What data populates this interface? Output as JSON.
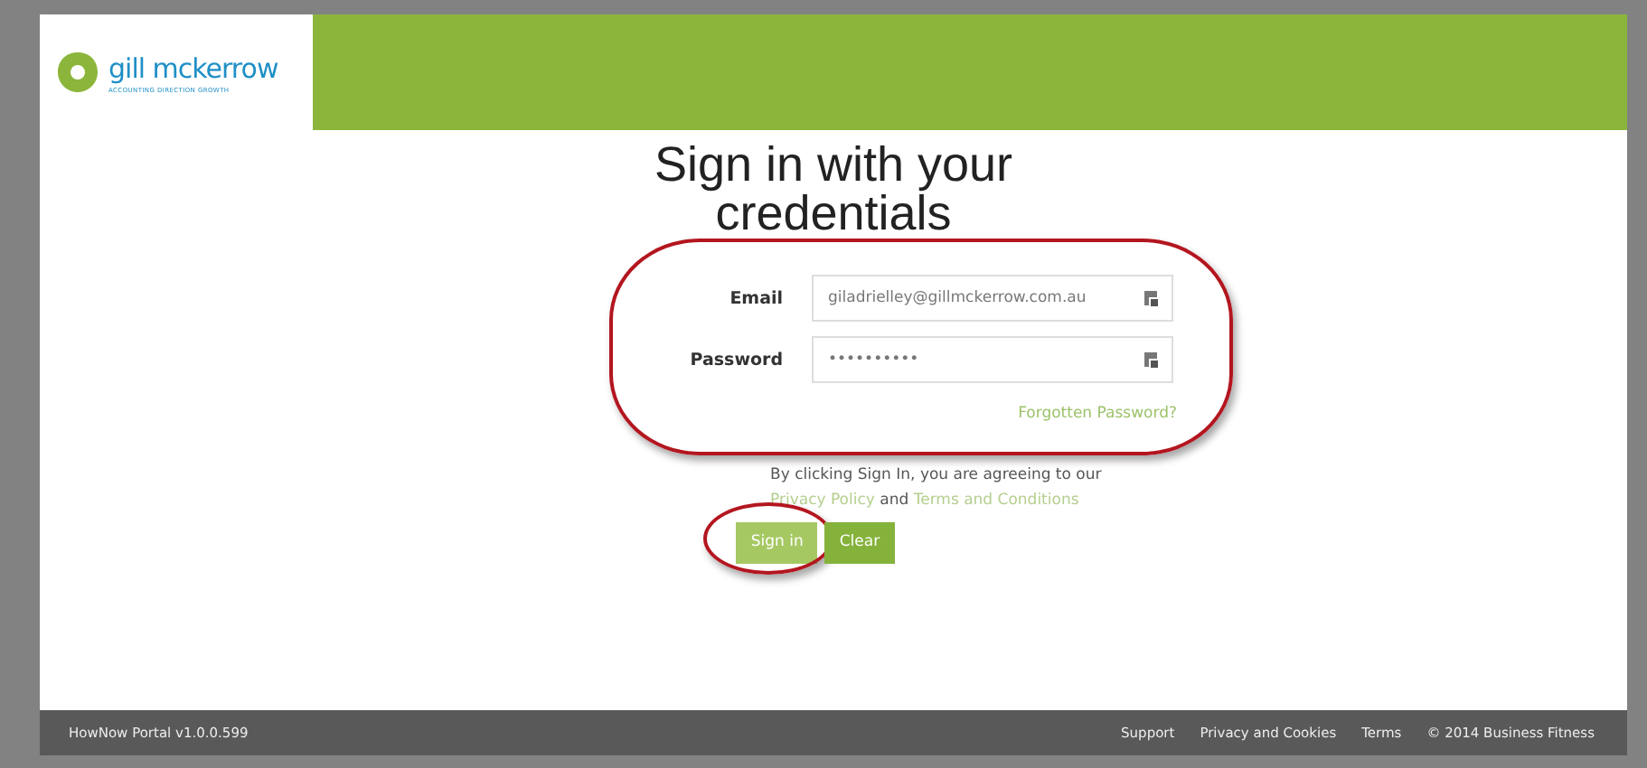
{
  "header": {
    "logo": {
      "name": "gill mckerrow",
      "tagline": "ACCOUNTING DIRECTION GROWTH"
    }
  },
  "title": "Sign in with your credentials",
  "form": {
    "highlighted": true,
    "fields": [
      {
        "label": "Email",
        "value": "giladrielley@gillmckerrow.com.au"
      },
      {
        "label": "Password",
        "value": "••••••••••"
      }
    ],
    "forgot_link": "Forgotten Password?"
  },
  "agreement": {
    "before": "By clicking Sign In, you are agreeing to our",
    "privacy_link": "Privacy Policy",
    "middle": "and",
    "terms_link": "Terms and Conditions"
  },
  "buttons": [
    {
      "label": "Sign in"
    },
    {
      "label": "Clear"
    }
  ],
  "sign_in_circled": true,
  "footer": {
    "version": "HowNow Portal v1.0.0.599",
    "links": [
      "Support",
      "Privacy and Cookies",
      "Terms"
    ],
    "copyright": "© 2014 Business Fitness"
  }
}
